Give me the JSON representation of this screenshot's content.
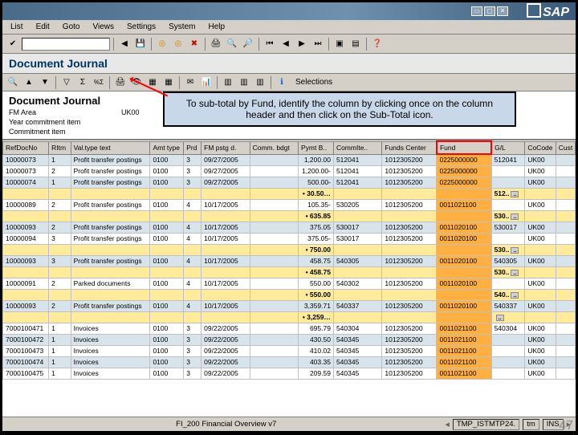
{
  "window": {
    "brand": "SAP"
  },
  "menu": [
    "List",
    "Edit",
    "Goto",
    "Views",
    "Settings",
    "System",
    "Help"
  ],
  "header": {
    "title": "Document Journal"
  },
  "subToolbar": {
    "selections_label": "Selections"
  },
  "info": {
    "title": "Document Journal",
    "rows": [
      {
        "label": "FM Area",
        "value": "UK00"
      },
      {
        "label": "Year commitment item",
        "value": ""
      },
      {
        "label": "Commitment item",
        "value": ""
      }
    ]
  },
  "callout": "To sub-total by Fund, identify the column by clicking once on the column header and then click on the Sub-Total icon.",
  "columns": [
    {
      "key": "refdoc",
      "label": "RefDocNo",
      "w": 52
    },
    {
      "key": "ritm",
      "label": "RItm",
      "w": 25
    },
    {
      "key": "valtype",
      "label": "Val.type text",
      "w": 90
    },
    {
      "key": "amttype",
      "label": "Amt type",
      "w": 38
    },
    {
      "key": "prd",
      "label": "Prd",
      "w": 20
    },
    {
      "key": "fmpstg",
      "label": "FM pstg d.",
      "w": 55
    },
    {
      "key": "commbdg",
      "label": "Comm. bdgt",
      "w": 55
    },
    {
      "key": "pymtb",
      "label": "Pymt B..",
      "w": 40
    },
    {
      "key": "commitem",
      "label": "CommIte..",
      "w": 55
    },
    {
      "key": "fundscenter",
      "label": "Funds Center",
      "w": 62
    },
    {
      "key": "fund",
      "label": "Fund",
      "w": 62,
      "highlight": true
    },
    {
      "key": "gl",
      "label": "G/L",
      "w": 38
    },
    {
      "key": "cocode",
      "label": "CoCode",
      "w": 35
    },
    {
      "key": "cust",
      "label": "Cust",
      "w": 22
    }
  ],
  "rows": [
    {
      "t": "d",
      "c": [
        "10000073",
        "1",
        "Profit transfer postings",
        "0100",
        "3",
        "09/27/2005",
        "",
        "1,200.00",
        "512041",
        "1012305200",
        "0225000000",
        "512041",
        "UK00",
        ""
      ]
    },
    {
      "t": "d",
      "c": [
        "10000073",
        "2",
        "Profit transfer postings",
        "0100",
        "3",
        "09/27/2005",
        "",
        "1,200.00-",
        "512041",
        "1012305200",
        "0225000000",
        "",
        "UK00",
        ""
      ]
    },
    {
      "t": "d",
      "c": [
        "10000074",
        "1",
        "Profit transfer postings",
        "0100",
        "3",
        "09/27/2005",
        "",
        "500.00-",
        "512041",
        "1012305200",
        "0225000000",
        "",
        "UK00",
        ""
      ]
    },
    {
      "t": "s",
      "label": "30.50…",
      "gl": "512.."
    },
    {
      "t": "d",
      "c": [
        "10000089",
        "2",
        "Profit transfer postings",
        "0100",
        "4",
        "10/17/2005",
        "",
        "105.35-",
        "530205",
        "1012305200",
        "0011021100",
        "",
        "UK00",
        ""
      ]
    },
    {
      "t": "s",
      "label": "635.85",
      "gl": "530.."
    },
    {
      "t": "d",
      "c": [
        "10000093",
        "2",
        "Profit transfer postings",
        "0100",
        "4",
        "10/17/2005",
        "",
        "375.05",
        "530017",
        "1012305200",
        "0011020100",
        "530017",
        "UK00",
        ""
      ]
    },
    {
      "t": "d",
      "c": [
        "10000094",
        "3",
        "Profit transfer postings",
        "0100",
        "4",
        "10/17/2005",
        "",
        "375.05-",
        "530017",
        "1012305200",
        "0011020100",
        "",
        "UK00",
        ""
      ]
    },
    {
      "t": "s",
      "label": "750.00",
      "gl": "530.."
    },
    {
      "t": "d",
      "c": [
        "10000093",
        "3",
        "Profit transfer postings",
        "0100",
        "4",
        "10/17/2005",
        "",
        "458.75",
        "540305",
        "1012305200",
        "0011020100",
        "540305",
        "UK00",
        ""
      ]
    },
    {
      "t": "s",
      "label": "458.75",
      "gl": "530.."
    },
    {
      "t": "d",
      "c": [
        "10000091",
        "2",
        "Parked documents",
        "0100",
        "4",
        "10/17/2005",
        "",
        "550.00",
        "540302",
        "1012305200",
        "0011020100",
        "",
        "UK00",
        ""
      ]
    },
    {
      "t": "s",
      "label": "550.00",
      "gl": "540.."
    },
    {
      "t": "d",
      "c": [
        "10000093",
        "2",
        "Profit transfer postings",
        "0100",
        "4",
        "10/17/2005",
        "",
        "3,359.71",
        "540337",
        "1012305200",
        "0011020100",
        "540337",
        "UK00",
        ""
      ]
    },
    {
      "t": "s",
      "label": "3,259…",
      "gl": ""
    },
    {
      "t": "d",
      "c": [
        "7000100471",
        "1",
        "Invoices",
        "0100",
        "3",
        "09/22/2005",
        "",
        "695.79",
        "540304",
        "1012305200",
        "0011021100",
        "540304",
        "UK00",
        ""
      ]
    },
    {
      "t": "d",
      "c": [
        "7000100472",
        "1",
        "Invoices",
        "0100",
        "3",
        "09/22/2005",
        "",
        "430.50",
        "540345",
        "1012305200",
        "0011021100",
        "",
        "UK00",
        ""
      ]
    },
    {
      "t": "d",
      "c": [
        "7000100473",
        "1",
        "Invoices",
        "0100",
        "3",
        "09/22/2005",
        "",
        "410.02",
        "540345",
        "1012305200",
        "0011021100",
        "",
        "UK00",
        ""
      ]
    },
    {
      "t": "d",
      "c": [
        "7000100474",
        "1",
        "Invoices",
        "0100",
        "3",
        "09/22/2005",
        "",
        "403.35",
        "540345",
        "1012305200",
        "0011021100",
        "",
        "UK00",
        ""
      ]
    },
    {
      "t": "d",
      "c": [
        "7000100475",
        "1",
        "Invoices",
        "0100",
        "3",
        "09/22/2005",
        "",
        "209.59",
        "540345",
        "1012305200",
        "0011021100",
        "",
        "UK00",
        ""
      ]
    }
  ],
  "status": {
    "center": "FI_200 Financial Overview v7",
    "right": [
      "TMP_ISTMTP24.",
      "tm",
      "INS"
    ]
  },
  "slideNumber": "47"
}
